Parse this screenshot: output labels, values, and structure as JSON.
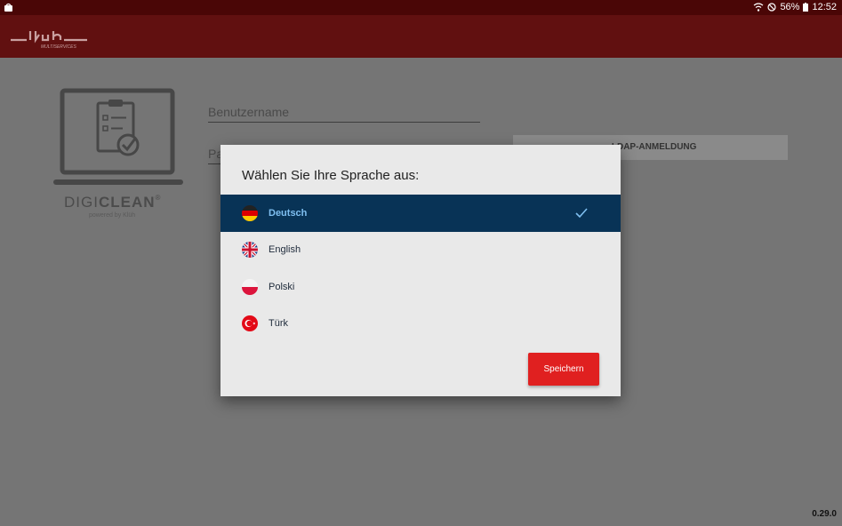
{
  "statusbar": {
    "battery": "56%",
    "time": "12:52"
  },
  "brand": {
    "logo_text": "klüh",
    "logo_sub": "MULTISERVICES",
    "product_prefix": "DIGI",
    "product_suffix": "CLEAN",
    "registered": "®",
    "powered_by": "powered by Klüh"
  },
  "login": {
    "username_placeholder": "Benutzername",
    "password_placeholder": "Pa",
    "ldap_button": "...LDAP-ANMELDUNG"
  },
  "dialog": {
    "title": "Wählen Sie Ihre Sprache aus:",
    "languages": [
      {
        "label": "Deutsch",
        "flag": "flag-germany-icon",
        "selected": true
      },
      {
        "label": "English",
        "flag": "flag-uk-icon",
        "selected": false
      },
      {
        "label": "Polski",
        "flag": "flag-poland-icon",
        "selected": false
      },
      {
        "label": "Türk",
        "flag": "flag-turkey-icon",
        "selected": false
      }
    ],
    "save_label": "Speichern"
  },
  "version": "0.29.0",
  "colors": {
    "statusbar": "#4a0606",
    "appbar": "#611010",
    "selected": "#083356",
    "save": "#e02020"
  }
}
